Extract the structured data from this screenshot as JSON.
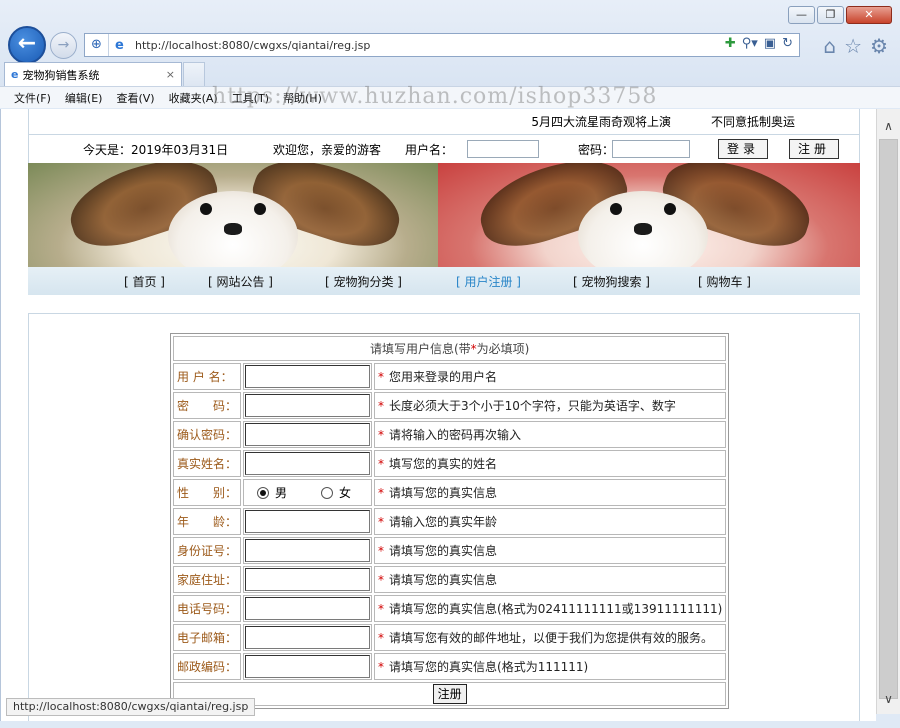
{
  "window": {
    "controls": [
      "—",
      "❐",
      "✕"
    ]
  },
  "browser": {
    "url": "http://localhost:8080/cwgxs/qiantai/reg.jsp",
    "tab_title": "宠物狗销售系统",
    "tab_close": "×",
    "menu": [
      "文件(F)",
      "编辑(E)",
      "查看(V)",
      "收藏夹(A)",
      "工具(T)",
      "帮助(H)"
    ],
    "watermark": "https://www.huzhan.com/ishop33758",
    "status_url": "http://localhost:8080/cwgxs/qiantai/reg.jsp"
  },
  "header": {
    "marquee_1": "5月四大流星雨奇观将上演",
    "marquee_2": "不同意抵制奥运",
    "date_text": "今天是：2019年03月31日",
    "welcome_text": "欢迎您，亲爱的游客",
    "username_label": "用户名：",
    "password_label": "密码：",
    "login_button": "登录",
    "register_button": "注册"
  },
  "nav": {
    "items": [
      {
        "label": "[ 首页 ]"
      },
      {
        "label": "[ 网站公告 ]"
      },
      {
        "label": "[ 宠物狗分类 ]"
      },
      {
        "label": "[ 用户注册 ]"
      },
      {
        "label": "[ 宠物狗搜索 ]"
      },
      {
        "label": "[ 购物车 ]"
      }
    ],
    "active_index": 3,
    "active_color": "#2a86c8"
  },
  "form": {
    "header_prefix": "请填写用户信息(带",
    "header_star": "*",
    "header_suffix": "为必填项)",
    "star": "*",
    "rows": [
      {
        "label": "用 户 名：",
        "note": "您用来登录的用户名"
      },
      {
        "label": "密　　码：",
        "note": "长度必须大于3个小于10个字符，只能为英语字、数字"
      },
      {
        "label": "确认密码：",
        "note": "请将输入的密码再次输入"
      },
      {
        "label": "真实姓名：",
        "note": "填写您的真实的姓名"
      },
      {
        "label": "性　　别：",
        "note": "请填写您的真实信息"
      },
      {
        "label": "年　　龄：",
        "note": "请输入您的真实年龄"
      },
      {
        "label": "身份证号：",
        "note": "请填写您的真实信息"
      },
      {
        "label": "家庭住址：",
        "note": "请填写您的真实信息"
      },
      {
        "label": "电话号码：",
        "note": "请填写您的真实信息(格式为02411111111或13911111111)"
      },
      {
        "label": "电子邮箱：",
        "note": "请填写您有效的邮件地址，以便于我们为您提供有效的服务。"
      },
      {
        "label": "邮政编码：",
        "note": "请填写您的真实信息(格式为111111)"
      }
    ],
    "gender_male": "男",
    "gender_female": "女",
    "gender_selected": "男",
    "submit_label": "注册"
  },
  "colors": {
    "label_color": "#9c5a1a",
    "required_star": "#d10000",
    "nav_bg": "#d6e5ef"
  }
}
